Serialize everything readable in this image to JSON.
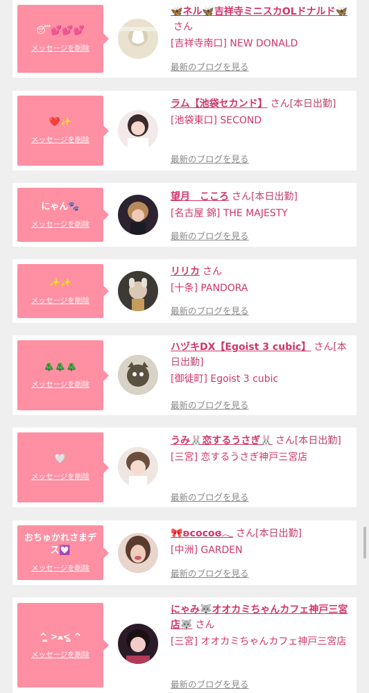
{
  "delete_label": "メッセージを削除",
  "blog_label": "最新のブログを見る",
  "san": "さん",
  "cards": [
    {
      "msg": "😴💕💕💕",
      "name": "🦋ネル🦋吉祥寺ミニスカOLドナルド🦋",
      "status": "",
      "shop": "[吉祥寺南口] NEW DONALD"
    },
    {
      "msg": "❤️✨",
      "name": "ラム【池袋セカンド】",
      "status": "[本日出勤]",
      "shop": "[池袋東口] SECOND"
    },
    {
      "msg": "にゃん🐾",
      "name": "望月　こころ",
      "status": "[本日出勤]",
      "shop": "[名古屋 錦] THE MAJESTY"
    },
    {
      "msg": "✨✨",
      "name": "リリカ",
      "status": "",
      "shop": "[十条] PANDORA"
    },
    {
      "msg": "🎄🎄🎄",
      "name": "ハヅキDX【Egoist 3 cubic】",
      "status": "[本日出勤]",
      "shop": "[御徒町] Egoist 3 cubic"
    },
    {
      "msg": "🤍",
      "name": "うみ🐰恋するうさぎ🐰",
      "status": "[本日出勤]",
      "shop": "[三宮] 恋するうさぎ神戸三宮店"
    },
    {
      "msg": "おちゅかれさまデス💟",
      "name": "🎀ʚcocoɞ𓂃",
      "status": "[本日出勤]",
      "shop": "[中洲] GARDEN"
    },
    {
      "msg": "^ ̳>ﻌ< ̳^",
      "name": "にゃみ🐺オオカミちゃんカフェ神戸三宮店🐺",
      "status": "",
      "shop": "[三宮] オオカミちゃんカフェ神戸三宮店"
    }
  ]
}
